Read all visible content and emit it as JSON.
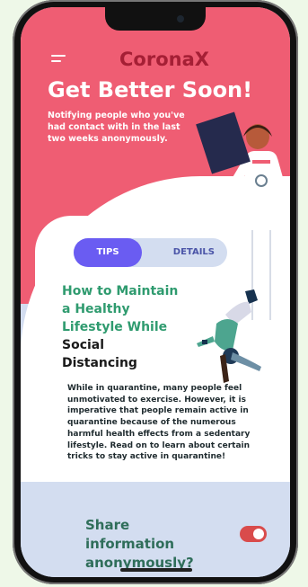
{
  "header": {
    "brand": "CoronaX",
    "title": "Get Better Soon!",
    "subtitle": "Notifying people who you've had contact with in the last two weeks anonymously."
  },
  "tabs": [
    {
      "label": "TIPS",
      "active": true
    },
    {
      "label": "DETAILS",
      "active": false
    }
  ],
  "article": {
    "title_line1": "How to Maintain",
    "title_line2": "a Healthy",
    "title_line3": "Lifestyle While",
    "title_line4": "Social",
    "title_line5": "Distancing",
    "body": "While in quarantine, many people feel unmotivated to exercise. However, it is imperative that people remain active in quarantine because of the numerous harmful health effects from a sedentary lifestyle. Read on to learn about certain tricks to stay active in quarantine!"
  },
  "share": {
    "label": "Share information anonymously?",
    "enabled": true
  },
  "colors": {
    "header_bg": "#ef5d73",
    "brand": "#a51f35",
    "accent": "#6a5cf2",
    "green_text": "#2f9b6f",
    "toggle_on": "#d94b4b"
  },
  "icons": [
    "menu-icon",
    "xray-illustration",
    "doctor-illustration",
    "dancer-illustration"
  ]
}
